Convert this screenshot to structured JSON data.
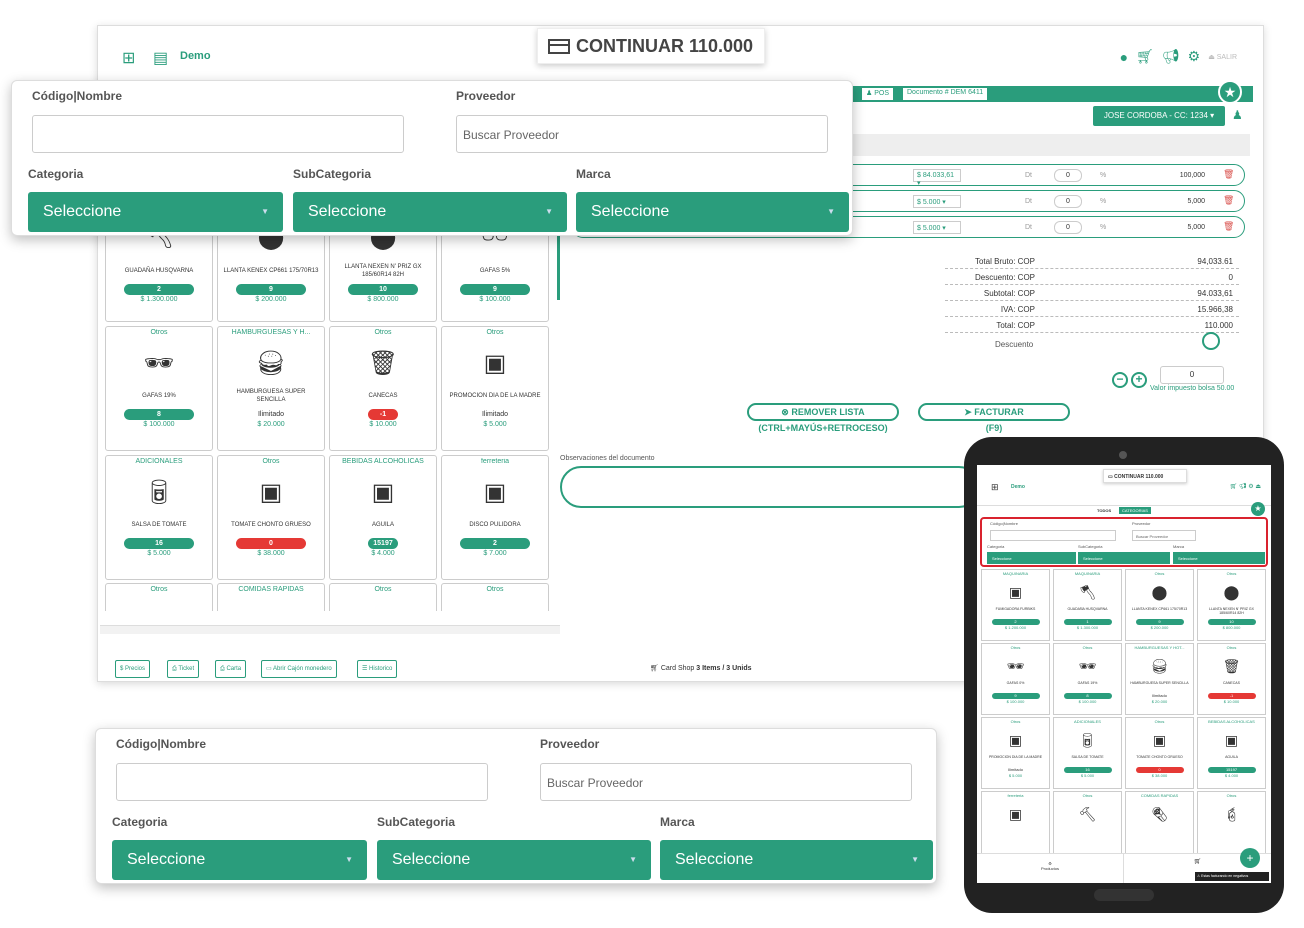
{
  "header": {
    "brand": "Demo",
    "continuar": "CONTINUAR 110.000",
    "salir": "SALIR"
  },
  "strip": {
    "pos": "POS",
    "documento": "Documento # DEM 6411"
  },
  "client": {
    "label": "JOSE CORDOBA - CC: 1234 ▾"
  },
  "items": [
    {
      "price": "$ 84.033,61 ▾",
      "dt": "Dt",
      "discount": "0",
      "pct": "%",
      "total": "100,000"
    },
    {
      "price": "$ 5.000 ▾",
      "dt": "Dt",
      "discount": "0",
      "pct": "%",
      "total": "5,000"
    },
    {
      "price": "$ 5.000 ▾",
      "dt": "Dt",
      "discount": "0",
      "pct": "%",
      "total": "5,000"
    }
  ],
  "summary": [
    {
      "label": "Total Bruto: COP",
      "value": "94,033.61"
    },
    {
      "label": "Descuento: COP",
      "value": "0"
    },
    {
      "label": "Subtotal: COP",
      "value": "94.033,61"
    },
    {
      "label": "IVA: COP",
      "value": "15.966,38"
    },
    {
      "label": "Total: COP",
      "value": "110.000"
    }
  ],
  "descuento_label": "Descuento",
  "bolsa": {
    "value": "0",
    "label": "Valor impuesto bolsa 50.00"
  },
  "actions": {
    "remover": "REMOVER LISTA",
    "remover_shortcut": "(CTRL+MAYÚS+RETROCESO)",
    "facturar": "FACTURAR",
    "facturar_shortcut": "(F9)"
  },
  "observaciones_label": "Observaciones del documento",
  "filter": {
    "codigo_label": "Código|Nombre",
    "proveedor_label": "Proveedor",
    "proveedor_placeholder": "Buscar Proveedor",
    "categoria_label": "Categoria",
    "subcategoria_label": "SubCategoria",
    "marca_label": "Marca",
    "select_default": "Seleccione"
  },
  "products_row1": [
    {
      "name": "GUADAÑA HUSQVARNA",
      "stock": "2",
      "price": "$ 1.300.000"
    },
    {
      "name": "LLANTA KENEX CP661 175/70R13",
      "stock": "9",
      "price": "$ 200.000"
    },
    {
      "name": "LLANTA NEXEN N' PRIZ GX 185/60R14 82H",
      "stock": "10",
      "price": "$ 800.000"
    },
    {
      "name": "GAFAS 5%",
      "stock": "9",
      "price": "$ 100.000"
    }
  ],
  "products_row2": [
    {
      "cat": "Otros",
      "name": "GAFAS 19%",
      "stock": "8",
      "price": "$ 100.000"
    },
    {
      "cat": "HAMBURGUESAS Y H...",
      "name": "HAMBURGUESA SUPER SENCILLA",
      "stock": "Ilimitado",
      "price": "$ 20.000"
    },
    {
      "cat": "Otros",
      "name": "CANECAS",
      "stock": "-1",
      "price": "$ 10.000"
    },
    {
      "cat": "Otros",
      "name": "PROMOCION DIA DE LA MADRE",
      "stock": "Ilimitado",
      "price": "$ 5.000"
    }
  ],
  "products_row3": [
    {
      "cat": "ADICIONALES",
      "name": "SALSA DE TOMATE",
      "stock": "16",
      "price": "$ 5.000"
    },
    {
      "cat": "Otros",
      "name": "TOMATE CHONTO GRUESO",
      "stock": "0",
      "price": "$ 38.000"
    },
    {
      "cat": "BEBIDAS ALCOHOLICAS",
      "name": "AGUILA",
      "stock": "15197",
      "price": "$ 4.000"
    },
    {
      "cat": "ferreteria",
      "name": "DISCO PULIDORA",
      "stock": "2",
      "price": "$ 7.000"
    }
  ],
  "products_row4": [
    {
      "cat": "Otros"
    },
    {
      "cat": "COMIDAS RAPIDAS"
    },
    {
      "cat": "Otros"
    },
    {
      "cat": "Otros"
    }
  ],
  "footer": {
    "precios": "Precios",
    "ticket": "Ticket",
    "carta": "Carta",
    "cajon": "Abrir Cajón monedero",
    "historico": "Historico",
    "cardshop": "Card Shop",
    "items": "3 Items /",
    "units": "3 Unids"
  },
  "tablet": {
    "continuar": "CONTINUAR 110.000",
    "brand": "Demo",
    "todos": "TODOS",
    "categorias": "CATEGORIAS",
    "productos": "Productos",
    "warning": "Estas facturando en negativos",
    "products": [
      {
        "cat": "MAQUINARIA",
        "name": "FUMIGADORA FURBIKS",
        "stock": "2",
        "price": "$ 1.200.000"
      },
      {
        "cat": "MAQUINARIA",
        "name": "GUADAÑA HUSQVARNA",
        "stock": "1",
        "price": "$ 1.300.000"
      },
      {
        "cat": "Otros",
        "name": "LLANTA KENEX CP661 175/70R13",
        "stock": "9",
        "price": "$ 200.000"
      },
      {
        "cat": "Otros",
        "name": "LLANTA NEXEN N' PRIZ GX 185/60R14 82H",
        "stock": "10",
        "price": "$ 800.000"
      },
      {
        "cat": "Otros",
        "name": "GAFAS 0%",
        "stock": "9",
        "price": "$ 100.000"
      },
      {
        "cat": "Otros",
        "name": "GAFAS 19%",
        "stock": "8",
        "price": "$ 100.000"
      },
      {
        "cat": "HAMBURGUESAS Y HOT...",
        "name": "HAMBURGUESA SUPER SENCILLA",
        "stock": "Ilimitado",
        "price": "$ 20.000"
      },
      {
        "cat": "Otros",
        "name": "CANECAS",
        "stock": "-1",
        "price": "$ 10.000"
      },
      {
        "cat": "Otros",
        "name": "PROMOCION DIA DE LA MADRE",
        "stock": "Ilimitado",
        "price": "$ 5.000"
      },
      {
        "cat": "ADICIONALES",
        "name": "SALSA DE TOMATE",
        "stock": "16",
        "price": "$ 5.000"
      },
      {
        "cat": "Otros",
        "name": "TOMATE CHONTO GRUESO",
        "stock": "0",
        "price": "$ 38.000"
      },
      {
        "cat": "BEBIDAS ALCOHOLICAS",
        "name": "AGUILA",
        "stock": "15197",
        "price": "$ 4.000"
      },
      {
        "cat": "ferreteria",
        "name": "",
        "stock": "",
        "price": ""
      },
      {
        "cat": "Otros",
        "name": "",
        "stock": "",
        "price": ""
      },
      {
        "cat": "COMIDAS RAPIDAS",
        "name": "",
        "stock": "",
        "price": ""
      },
      {
        "cat": "Otros",
        "name": "",
        "stock": "",
        "price": ""
      }
    ]
  },
  "colors": {
    "accent": "#2a9d7c",
    "danger": "#e53935"
  }
}
